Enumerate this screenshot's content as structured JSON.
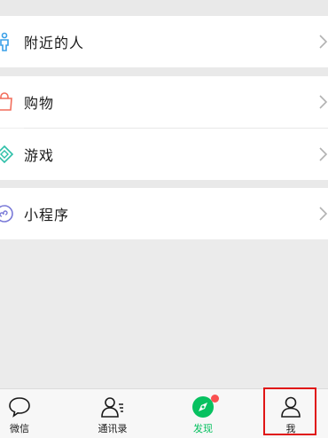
{
  "menu": {
    "nearby": {
      "label": "附近的人",
      "icon": "person-icon"
    },
    "shopping": {
      "label": "购物",
      "icon": "shopping-bag-icon"
    },
    "games": {
      "label": "游戏",
      "icon": "diamond-icon"
    },
    "mini_programs": {
      "label": "小程序",
      "icon": "mini-program-icon"
    }
  },
  "tabbar": {
    "tabs": [
      {
        "label": "微信",
        "icon": "chat-bubble-icon"
      },
      {
        "label": "通讯录",
        "icon": "contacts-icon"
      },
      {
        "label": "发现",
        "icon": "compass-icon",
        "active": true,
        "badge": "red-dot"
      },
      {
        "label": "我",
        "icon": "profile-icon",
        "highlighted": true
      }
    ]
  },
  "colors": {
    "accent_green": "#07c160",
    "badge_red": "#fa5151",
    "highlight_red": "#e01515",
    "background": "#ededed"
  }
}
